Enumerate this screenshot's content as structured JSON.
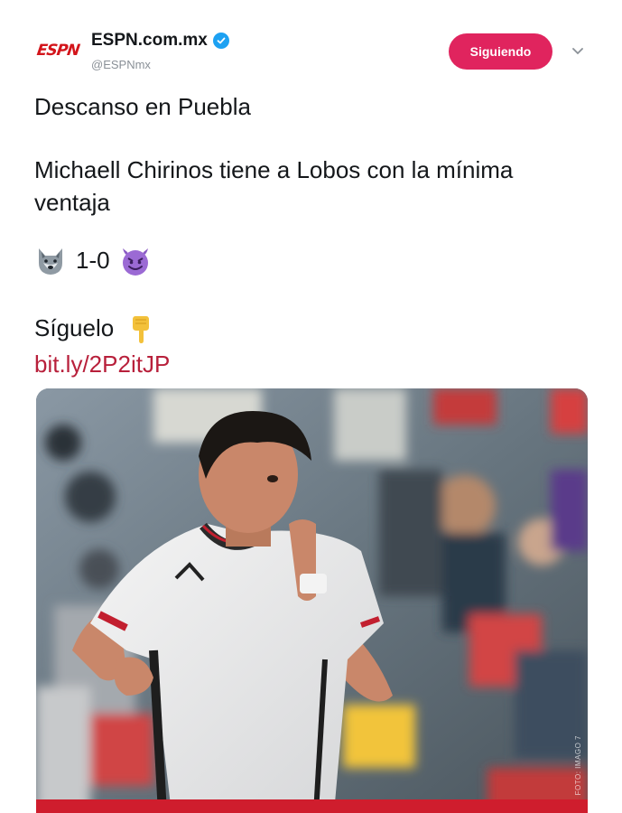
{
  "account": {
    "avatar_text": "ESPN",
    "display_name": "ESPN.com.mx",
    "handle": "@ESPNmx",
    "verified": true
  },
  "actions": {
    "follow_label": "Siguiendo"
  },
  "tweet": {
    "line1": "Descanso en Puebla",
    "line2": "Michaell Chirinos tiene a Lobos con la mínima",
    "line3": "ventaja",
    "score": "1-0",
    "cta": "Síguelo",
    "link": "bit.ly/2P2itJP",
    "emojis": [
      "wolf-face-emoji",
      "smiling-imp-emoji",
      "backhand-index-pointing-down-emoji"
    ]
  },
  "media": {
    "description_icon": "soccer-player-photo",
    "credit": "FOTO: IMAGO 7"
  },
  "colors": {
    "brand_red": "#d3151b",
    "follow_button": "#e0245e",
    "link": "#b8203b",
    "verified_blue": "#1da1f2"
  }
}
